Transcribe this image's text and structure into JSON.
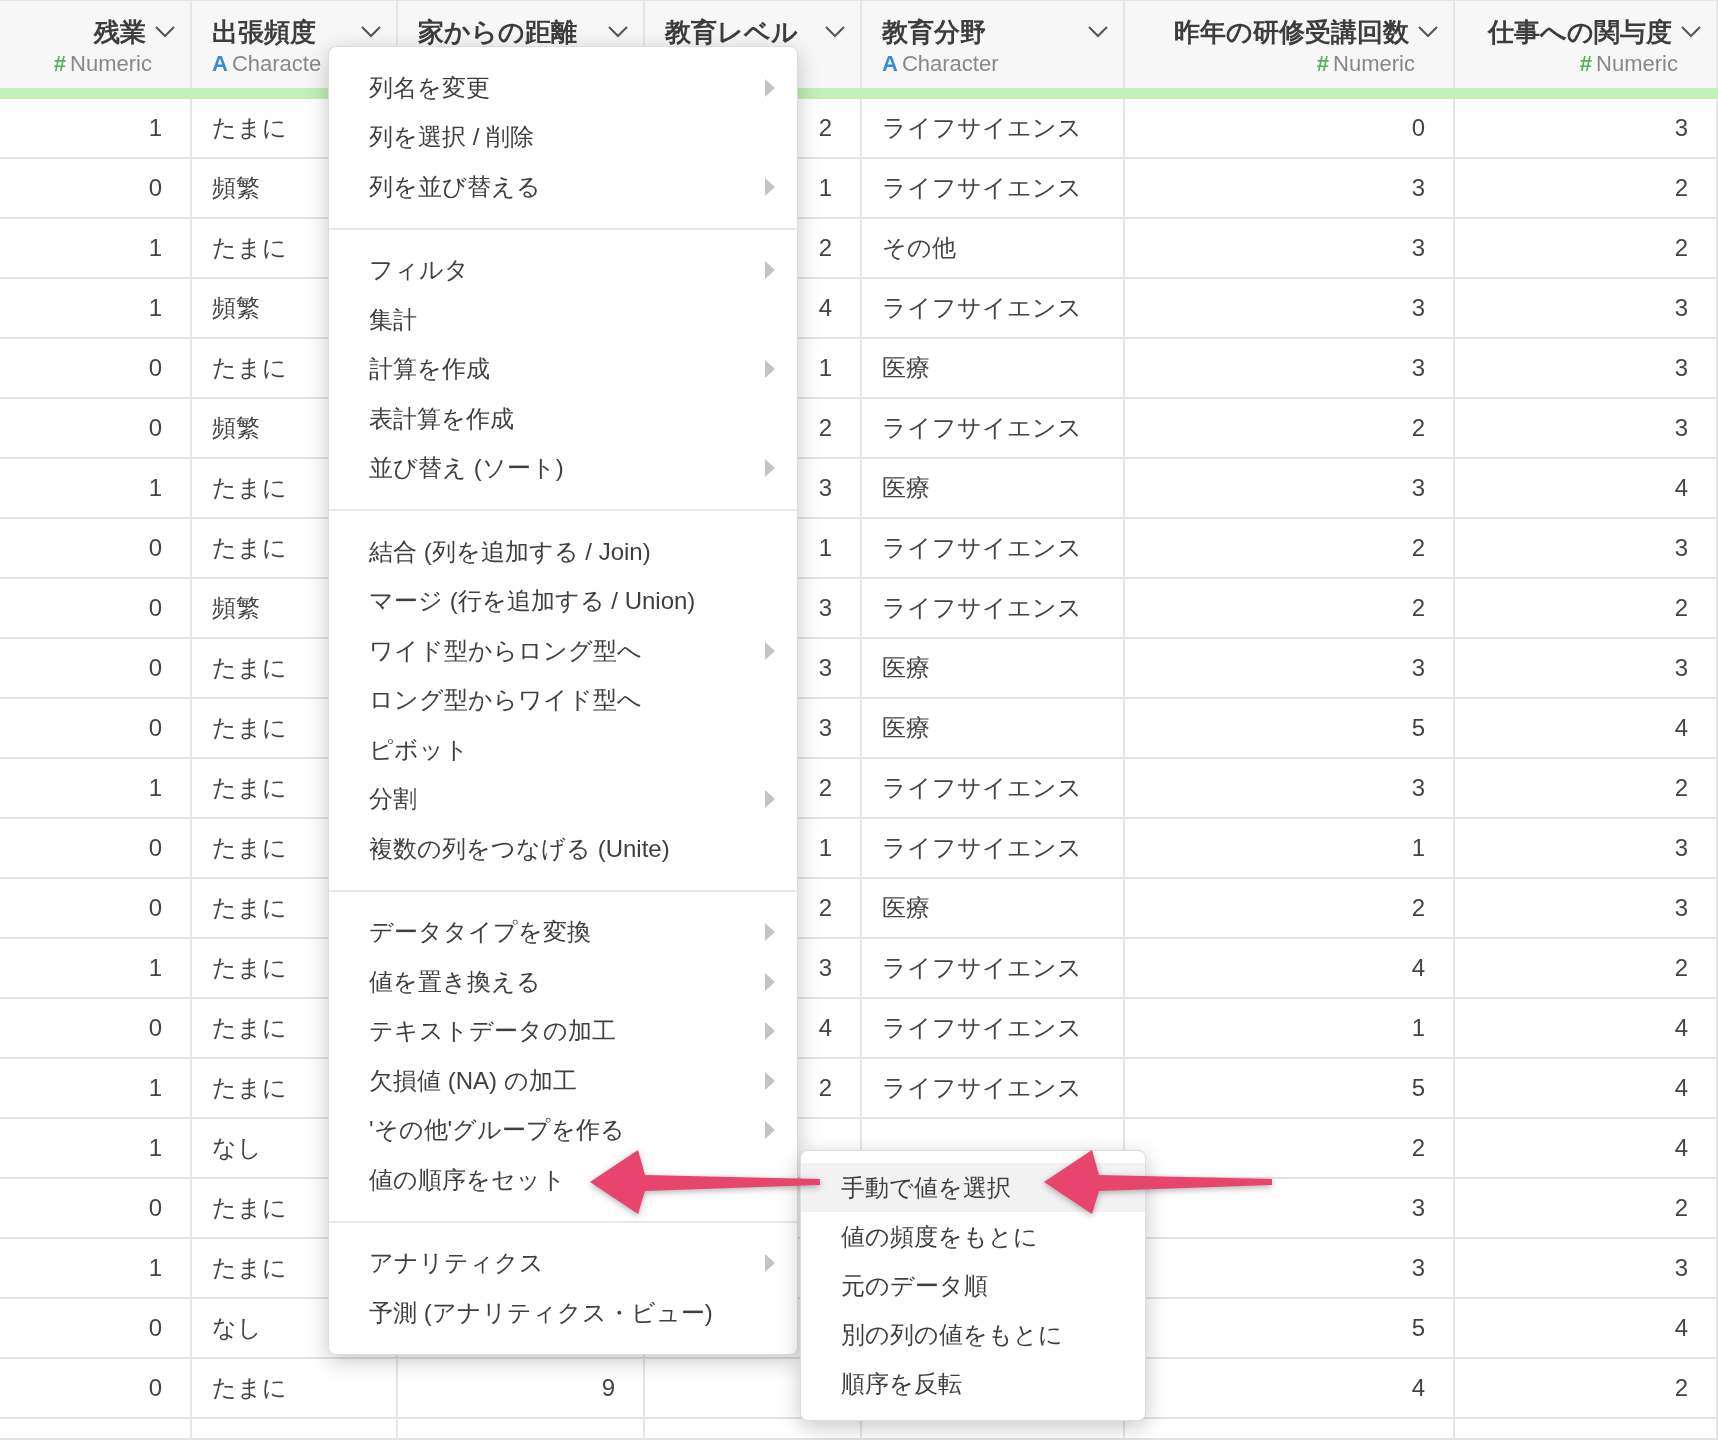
{
  "columns": [
    {
      "title": "残業",
      "kind": "numeric",
      "type_icon": "#",
      "type_label": "Numeric"
    },
    {
      "title": "出張頻度",
      "kind": "character",
      "type_icon": "A",
      "type_label": "Characte"
    },
    {
      "title": "家からの距離"
    },
    {
      "title": "教育レベル"
    },
    {
      "title": "教育分野",
      "kind": "character",
      "type_icon": "A",
      "type_label": "Character"
    },
    {
      "title": "昨年の研修受講回数",
      "kind": "numeric",
      "type_icon": "#",
      "type_label": "Numeric"
    },
    {
      "title": "仕事への関与度",
      "kind": "numeric",
      "type_icon": "#",
      "type_label": "Numeric"
    }
  ],
  "rows": [
    {
      "overtime": "1",
      "travel": "たまに",
      "education_level": "2",
      "education_field": "ライフサイエンス",
      "trainings": "0",
      "involvement": "3"
    },
    {
      "overtime": "0",
      "travel": "頻繁",
      "education_level": "1",
      "education_field": "ライフサイエンス",
      "trainings": "3",
      "involvement": "2"
    },
    {
      "overtime": "1",
      "travel": "たまに",
      "education_level": "2",
      "education_field": "その他",
      "trainings": "3",
      "involvement": "2"
    },
    {
      "overtime": "1",
      "travel": "頻繁",
      "education_level": "4",
      "education_field": "ライフサイエンス",
      "trainings": "3",
      "involvement": "3"
    },
    {
      "overtime": "0",
      "travel": "たまに",
      "education_level": "1",
      "education_field": "医療",
      "trainings": "3",
      "involvement": "3"
    },
    {
      "overtime": "0",
      "travel": "頻繁",
      "education_level": "2",
      "education_field": "ライフサイエンス",
      "trainings": "2",
      "involvement": "3"
    },
    {
      "overtime": "1",
      "travel": "たまに",
      "education_level": "3",
      "education_field": "医療",
      "trainings": "3",
      "involvement": "4"
    },
    {
      "overtime": "0",
      "travel": "たまに",
      "education_level": "1",
      "education_field": "ライフサイエンス",
      "trainings": "2",
      "involvement": "3"
    },
    {
      "overtime": "0",
      "travel": "頻繁",
      "education_level": "3",
      "education_field": "ライフサイエンス",
      "trainings": "2",
      "involvement": "2"
    },
    {
      "overtime": "0",
      "travel": "たまに",
      "education_level": "3",
      "education_field": "医療",
      "trainings": "3",
      "involvement": "3"
    },
    {
      "overtime": "0",
      "travel": "たまに",
      "education_level": "3",
      "education_field": "医療",
      "trainings": "5",
      "involvement": "4"
    },
    {
      "overtime": "1",
      "travel": "たまに",
      "education_level": "2",
      "education_field": "ライフサイエンス",
      "trainings": "3",
      "involvement": "2"
    },
    {
      "overtime": "0",
      "travel": "たまに",
      "education_level": "1",
      "education_field": "ライフサイエンス",
      "trainings": "1",
      "involvement": "3"
    },
    {
      "overtime": "0",
      "travel": "たまに",
      "education_level": "2",
      "education_field": "医療",
      "trainings": "2",
      "involvement": "3"
    },
    {
      "overtime": "1",
      "travel": "たまに",
      "education_level": "3",
      "education_field": "ライフサイエンス",
      "trainings": "4",
      "involvement": "2"
    },
    {
      "overtime": "0",
      "travel": "たまに",
      "education_level": "4",
      "education_field": "ライフサイエンス",
      "trainings": "1",
      "involvement": "4"
    },
    {
      "overtime": "1",
      "travel": "たまに",
      "education_level": "2",
      "education_field": "ライフサイエンス",
      "trainings": "5",
      "involvement": "4"
    },
    {
      "overtime": "1",
      "travel": "なし",
      "trainings": "2",
      "involvement": "4"
    },
    {
      "overtime": "0",
      "travel": "たまに",
      "trainings": "3",
      "involvement": "2"
    },
    {
      "overtime": "1",
      "travel": "たまに",
      "trainings": "3",
      "involvement": "3"
    },
    {
      "overtime": "0",
      "travel": "なし",
      "trainings": "5",
      "involvement": "4"
    },
    {
      "overtime": "0",
      "travel": "たまに",
      "distance": "9",
      "trainings": "4",
      "involvement": "2"
    }
  ],
  "menu": {
    "groups": [
      [
        {
          "label": "列名を変更",
          "submenu": true
        },
        {
          "label": "列を選択 / 削除",
          "submenu": false
        },
        {
          "label": "列を並び替える",
          "submenu": true
        }
      ],
      [
        {
          "label": "フィルタ",
          "submenu": true
        },
        {
          "label": "集計",
          "submenu": false
        },
        {
          "label": "計算を作成",
          "submenu": true
        },
        {
          "label": "表計算を作成",
          "submenu": false
        },
        {
          "label": "並び替え (ソート)",
          "submenu": true
        }
      ],
      [
        {
          "label": "結合 (列を追加する / Join)",
          "submenu": false
        },
        {
          "label": "マージ (行を追加する / Union)",
          "submenu": false
        },
        {
          "label": "ワイド型からロング型へ",
          "submenu": true
        },
        {
          "label": "ロング型からワイド型へ",
          "submenu": false
        },
        {
          "label": "ピボット",
          "submenu": false
        },
        {
          "label": "分割",
          "submenu": true
        },
        {
          "label": "複数の列をつなげる (Unite)",
          "submenu": false
        }
      ],
      [
        {
          "label": "データタイプを変換",
          "submenu": true
        },
        {
          "label": "値を置き換える",
          "submenu": true
        },
        {
          "label": "テキストデータの加工",
          "submenu": true
        },
        {
          "label": "欠損値 (NA) の加工",
          "submenu": true
        },
        {
          "label": "'その他'グループを作る",
          "submenu": true
        },
        {
          "label": "値の順序をセット",
          "submenu": false
        }
      ],
      [
        {
          "label": "アナリティクス",
          "submenu": true
        },
        {
          "label": "予測 (アナリティクス・ビュー)",
          "submenu": false
        }
      ]
    ]
  },
  "submenu": {
    "items": [
      {
        "label": "手動で値を選択",
        "selected": true
      },
      {
        "label": "値の頻度をもとに",
        "selected": false
      },
      {
        "label": "元のデータ順",
        "selected": false
      },
      {
        "label": "別の列の値をもとに",
        "selected": false
      },
      {
        "label": "順序を反転",
        "selected": false
      }
    ]
  }
}
